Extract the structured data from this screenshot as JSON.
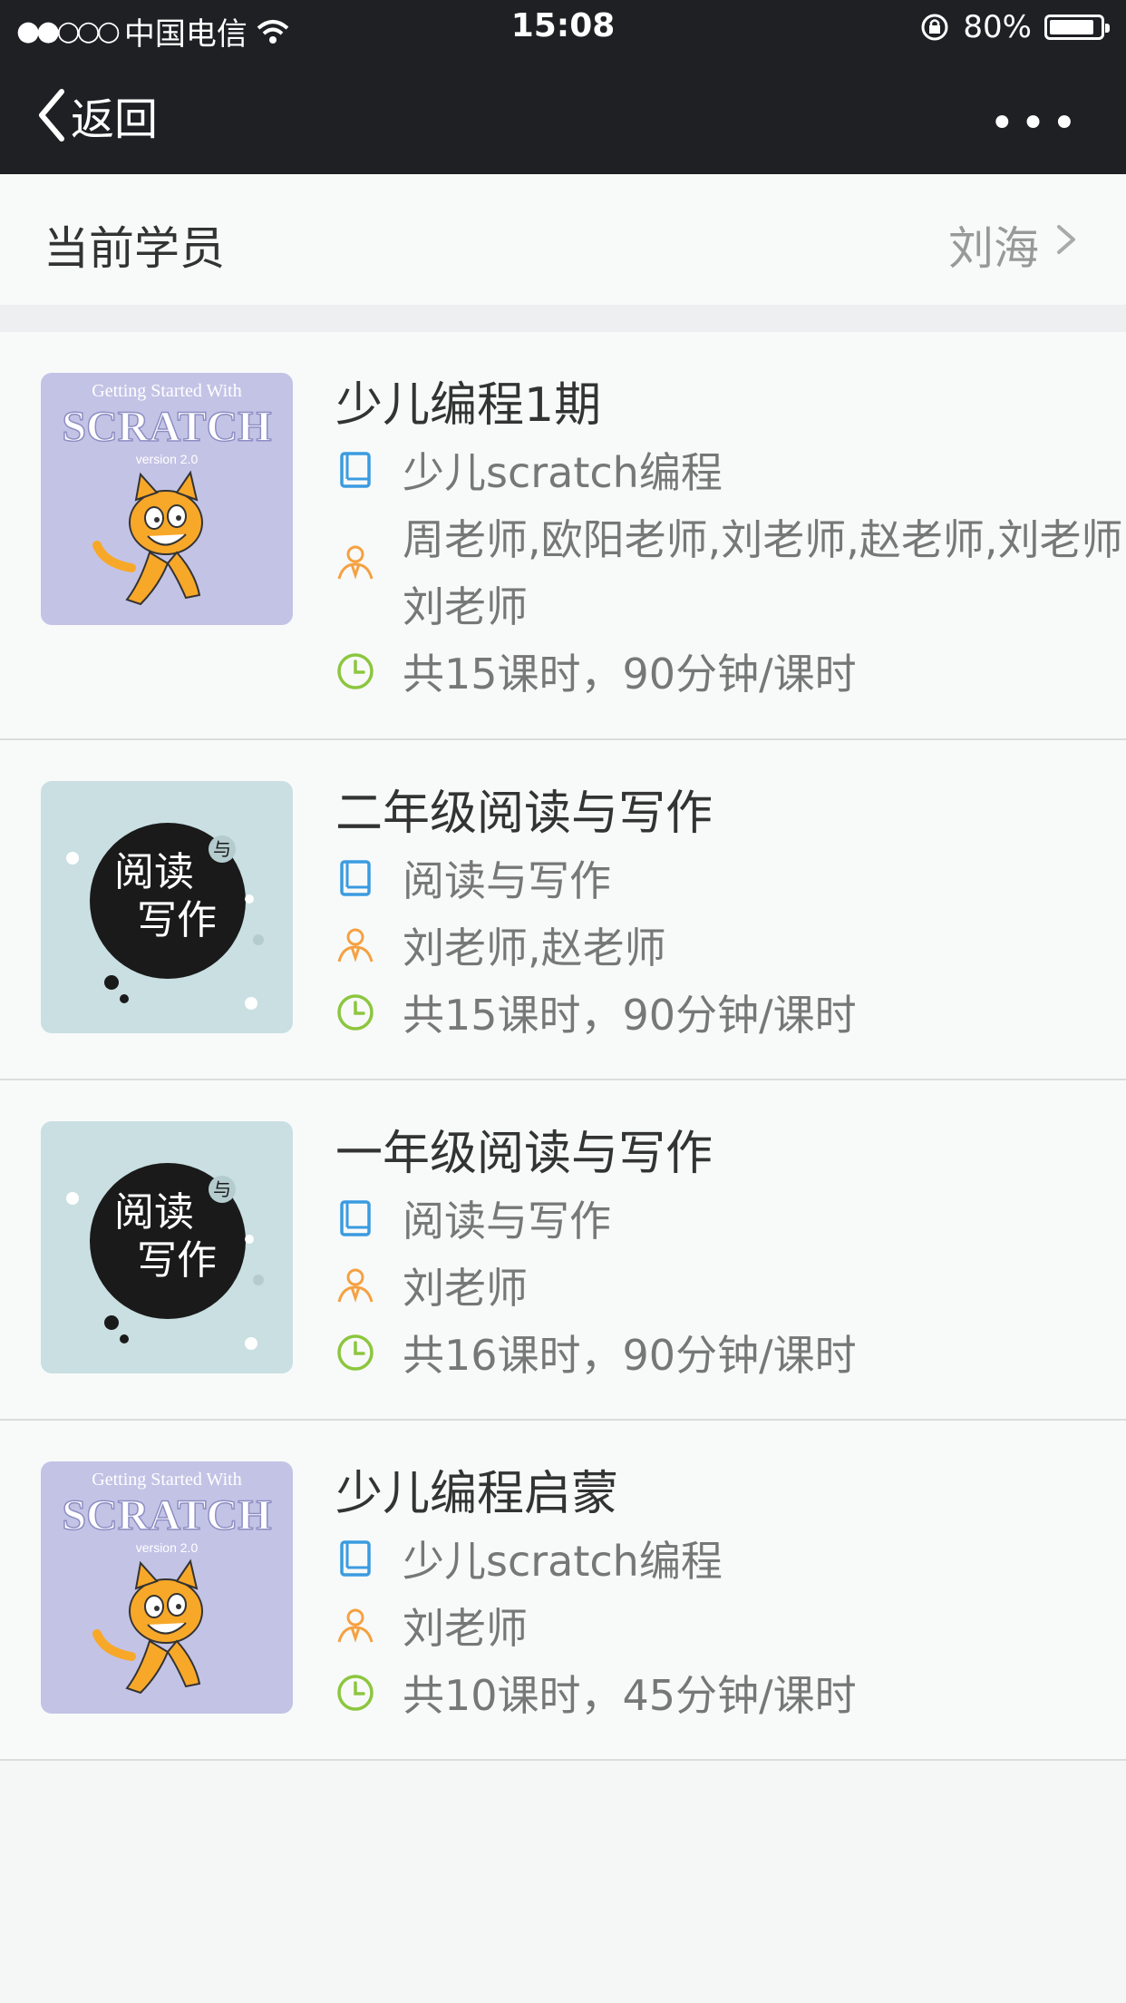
{
  "status": {
    "carrier": "中国电信",
    "time": "15:08",
    "battery": "80%"
  },
  "nav": {
    "back_label": "返回",
    "more_label": "•••"
  },
  "student": {
    "label": "当前学员",
    "name": "刘海"
  },
  "courses": [
    {
      "title": "少儿编程1期",
      "subject": "少儿scratch编程",
      "teachers": "周老师,欧阳老师,刘老师,赵老师,刘老师,刘老师",
      "hours": "共15课时，90分钟/课时",
      "cover": "scratch"
    },
    {
      "title": "二年级阅读与写作",
      "subject": "阅读与写作",
      "teachers": "刘老师,赵老师",
      "hours": "共15课时，90分钟/课时",
      "cover": "reading"
    },
    {
      "title": "一年级阅读与写作",
      "subject": "阅读与写作",
      "teachers": "刘老师",
      "hours": "共16课时，90分钟/课时",
      "cover": "reading"
    },
    {
      "title": "少儿编程启蒙",
      "subject": "少儿scratch编程",
      "teachers": "刘老师",
      "hours": "共10课时，45分钟/课时",
      "cover": "scratch"
    }
  ],
  "covers": {
    "scratch": {
      "line1": "Getting Started With",
      "line2": "SCRATCH",
      "line3": "version 2.0"
    },
    "reading": {
      "line1": "阅读",
      "line2": "写作",
      "badge": "与"
    }
  },
  "colors": {
    "book_icon": "#3b9be0",
    "teacher_icon": "#f5a142",
    "clock_icon": "#8cc63e"
  }
}
